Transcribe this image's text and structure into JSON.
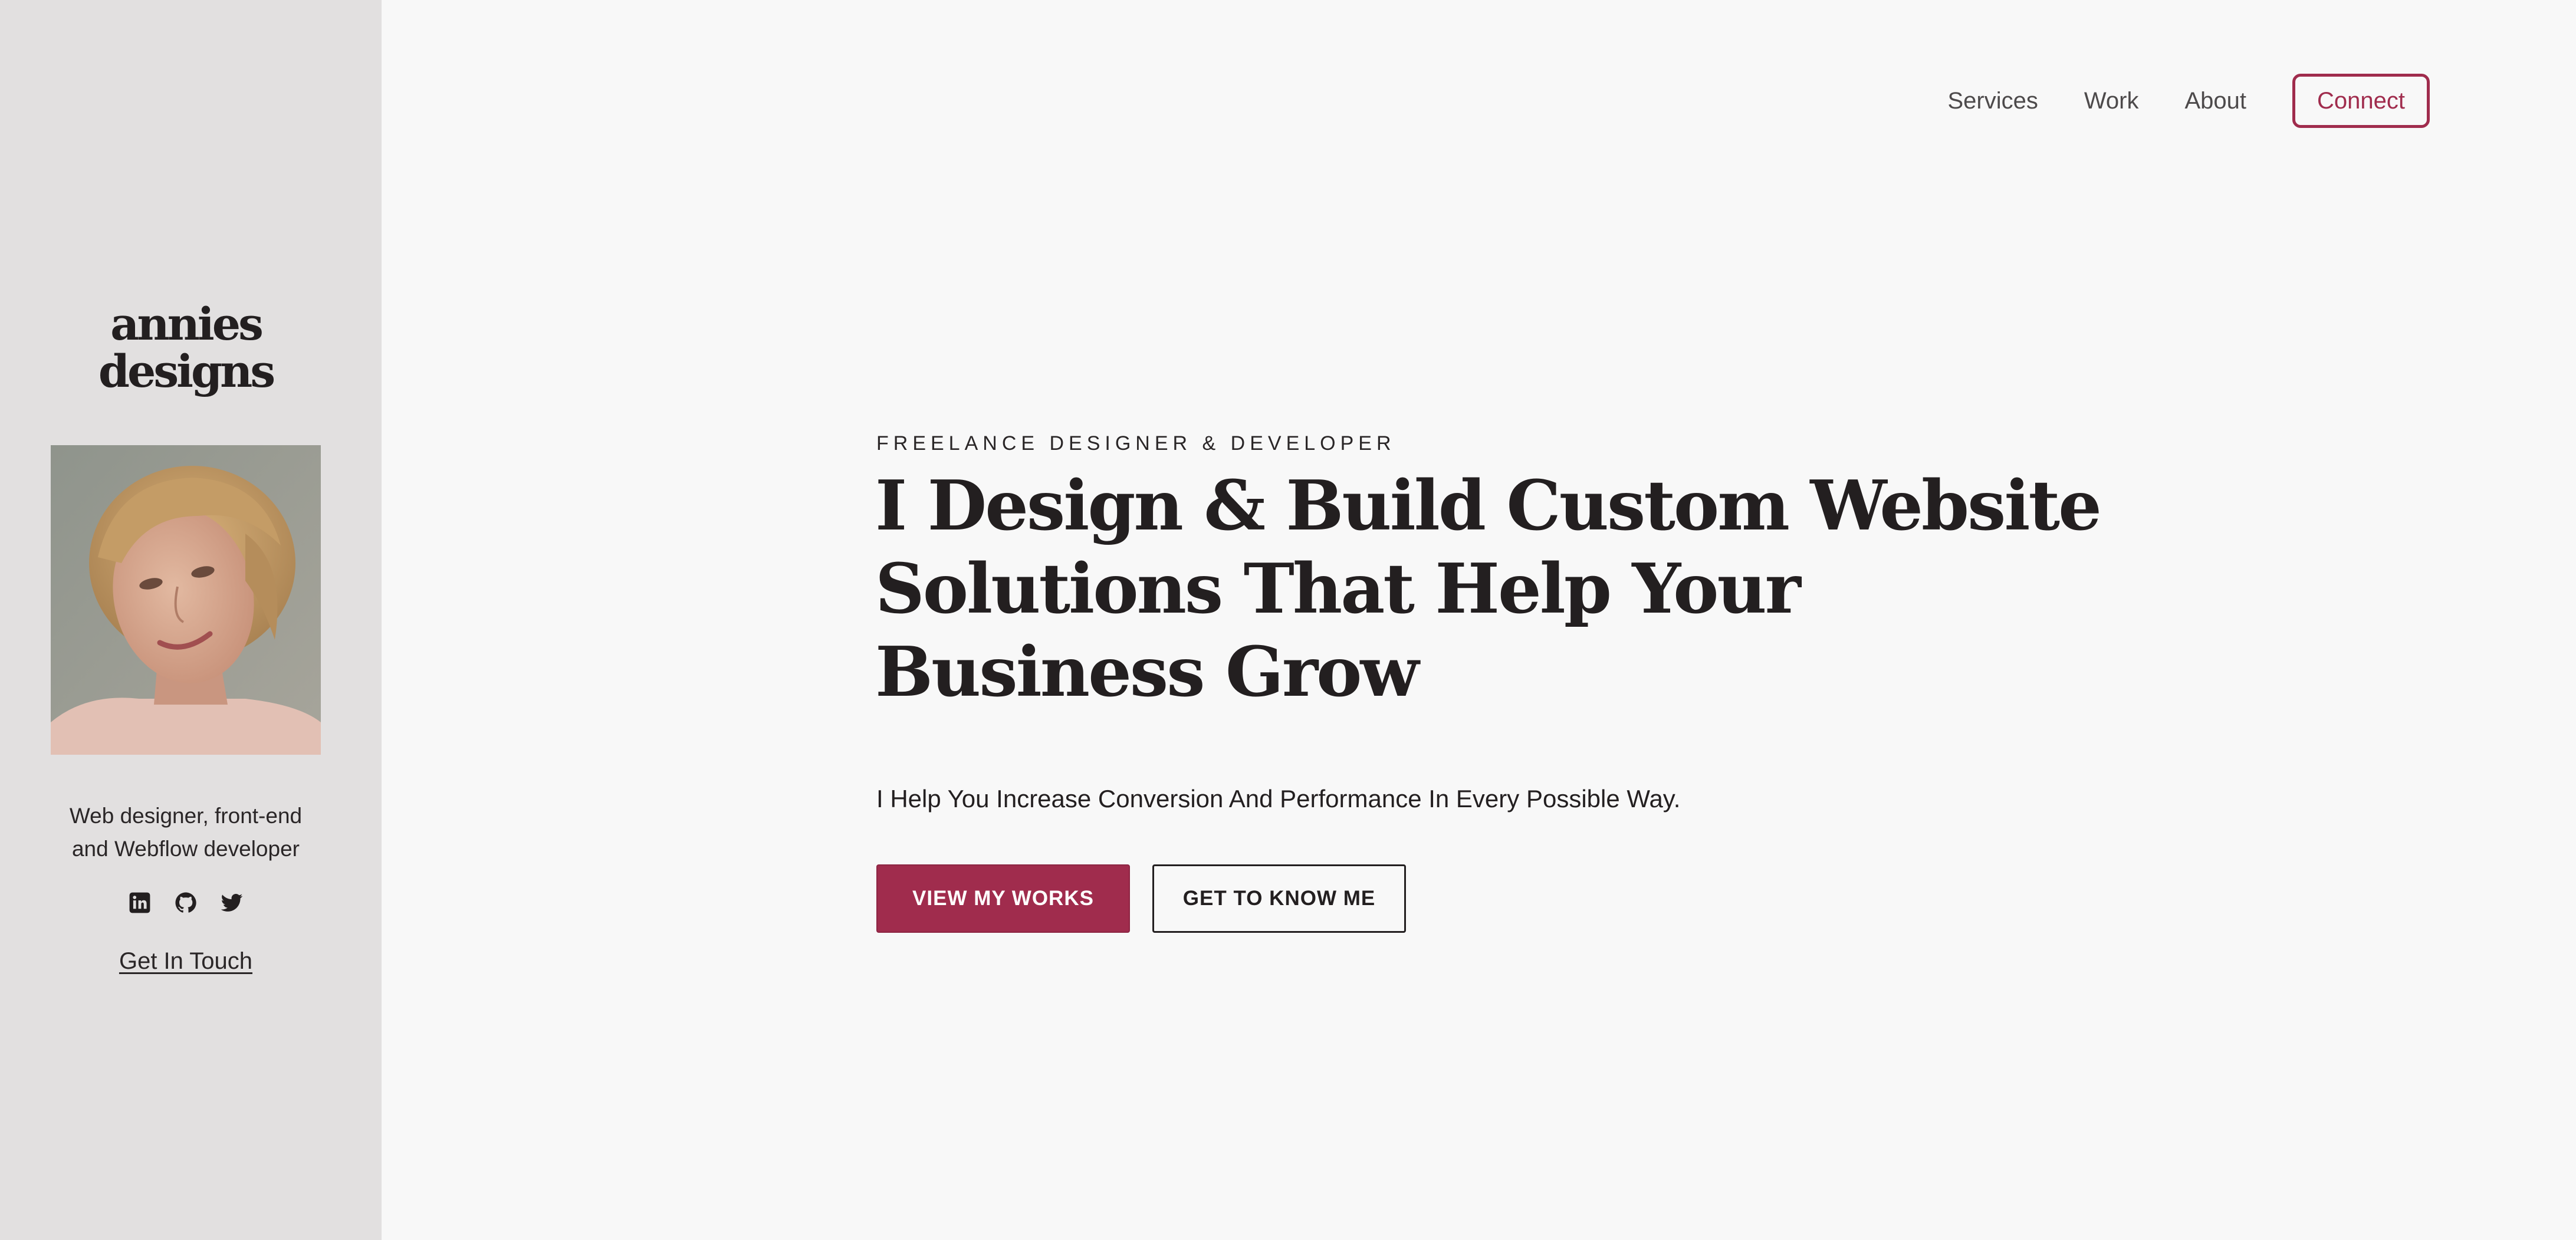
{
  "sidebar": {
    "logo_line1": "annies",
    "logo_line2": "designs",
    "avatar_alt": "Portrait photo",
    "tagline_line1": "Web designer, front-end",
    "tagline_line2": "and Webflow developer",
    "socials": [
      {
        "icon": "linkedin-icon",
        "label": "LinkedIn"
      },
      {
        "icon": "github-icon",
        "label": "GitHub"
      },
      {
        "icon": "twitter-icon",
        "label": "Twitter"
      }
    ],
    "cta_link": "Get In Touch"
  },
  "nav": {
    "items": [
      "Services",
      "Work",
      "About"
    ],
    "connect_label": "Connect"
  },
  "hero": {
    "eyebrow": "FREELANCE DESIGNER & DEVELOPER",
    "headline_lines": [
      "I Design & Build Custom Website",
      "Solutions That Help Your",
      "Business Grow"
    ],
    "subhead": "I Help You Increase Conversion And Performance In Every Possible Way.",
    "primary_button": "VIEW MY WORKS",
    "secondary_button": "GET TO KNOW ME"
  },
  "colors": {
    "accent": "#a02c4d",
    "sidebar_bg": "#e2e0e0",
    "page_bg": "#f8f8f8",
    "text": "#231f20"
  }
}
